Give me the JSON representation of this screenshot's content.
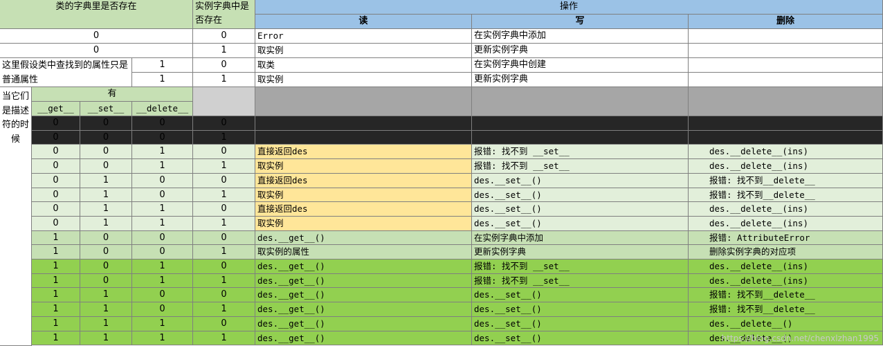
{
  "header": {
    "class_exists": "类的字典里是否存在",
    "instance_exists": "实例字典中是否存在",
    "operation": "操作",
    "read": "读",
    "write": "写",
    "delete": "删除"
  },
  "top_rows": [
    {
      "class": "0",
      "inst": "0",
      "read": "Error",
      "write": "在实例字典中添加",
      "delete": ""
    },
    {
      "class": "0",
      "inst": "1",
      "read": "取实例",
      "write": "更新实例字典",
      "delete": ""
    },
    {
      "class": "1",
      "inst": "0",
      "read": "取类",
      "write": "在实例字典中创建",
      "delete": ""
    },
    {
      "class": "1",
      "inst": "1",
      "read": "取实例",
      "write": "更新实例字典",
      "delete": ""
    }
  ],
  "note": "这里假设类中查找到的属性只是普通属性",
  "descriptor": {
    "side_label": "当它们是描述符的时候",
    "has_label": "有",
    "cols": [
      "__get__",
      "__set__",
      "__delete__"
    ]
  },
  "rows": [
    {
      "g": "0",
      "s": "0",
      "d": "0",
      "inst": "0",
      "read": "",
      "write": "",
      "delete": "",
      "style": "black"
    },
    {
      "g": "0",
      "s": "0",
      "d": "0",
      "inst": "1",
      "read": "",
      "write": "",
      "delete": "",
      "style": "black"
    },
    {
      "g": "0",
      "s": "0",
      "d": "1",
      "inst": "0",
      "read": "直接返回des",
      "write": "报错: 找不到 __set__",
      "delete": "des.__delete__(ins)",
      "style": "pale"
    },
    {
      "g": "0",
      "s": "0",
      "d": "1",
      "inst": "1",
      "read": "取实例",
      "write": "报错: 找不到 __set__",
      "delete": "des.__delete__(ins)",
      "style": "pale"
    },
    {
      "g": "0",
      "s": "1",
      "d": "0",
      "inst": "0",
      "read": "直接返回des",
      "write": "des.__set__()",
      "delete": "报错: 找不到__delete__",
      "style": "pale"
    },
    {
      "g": "0",
      "s": "1",
      "d": "0",
      "inst": "1",
      "read": "取实例",
      "write": "des.__set__()",
      "delete": "报错: 找不到__delete__",
      "style": "pale"
    },
    {
      "g": "0",
      "s": "1",
      "d": "1",
      "inst": "0",
      "read": "直接返回des",
      "write": "des.__set__()",
      "delete": "des.__delete__(ins)",
      "style": "pale"
    },
    {
      "g": "0",
      "s": "1",
      "d": "1",
      "inst": "1",
      "read": "取实例",
      "write": "des.__set__()",
      "delete": "des.__delete__(ins)",
      "style": "pale"
    },
    {
      "g": "1",
      "s": "0",
      "d": "0",
      "inst": "0",
      "read": "des.__get__()",
      "write": "在实例字典中添加",
      "delete": "报错: AttributeError",
      "style": "mid"
    },
    {
      "g": "1",
      "s": "0",
      "d": "0",
      "inst": "1",
      "read": "取实例的属性",
      "write": "更新实例字典",
      "delete": "删除实例字典的对应项",
      "style": "mid"
    },
    {
      "g": "1",
      "s": "0",
      "d": "1",
      "inst": "0",
      "read": "des.__get__()",
      "write": "报错: 找不到 __set__",
      "delete": "des.__delete__(ins)",
      "style": "green"
    },
    {
      "g": "1",
      "s": "0",
      "d": "1",
      "inst": "1",
      "read": "des.__get__()",
      "write": "报错: 找不到 __set__",
      "delete": "des.__delete__(ins)",
      "style": "green"
    },
    {
      "g": "1",
      "s": "1",
      "d": "0",
      "inst": "0",
      "read": "des.__get__()",
      "write": "des.__set__()",
      "delete": "报错: 找不到__delete__",
      "style": "green"
    },
    {
      "g": "1",
      "s": "1",
      "d": "0",
      "inst": "1",
      "read": "des.__get__()",
      "write": "des.__set__()",
      "delete": "报错: 找不到__delete__",
      "style": "green"
    },
    {
      "g": "1",
      "s": "1",
      "d": "1",
      "inst": "0",
      "read": "des.__get__()",
      "write": "des.__set__()",
      "delete": "des.__delete__()",
      "style": "green"
    },
    {
      "g": "1",
      "s": "1",
      "d": "1",
      "inst": "1",
      "read": "des.__get__()",
      "write": "des.__set__()",
      "delete": "des.__delete__()",
      "style": "green"
    }
  ],
  "colors": {
    "header_green": "#c6e0b4",
    "header_blue": "#9bc2e6",
    "gray_light": "#d0d0d0",
    "gray_dark": "#a6a6a6",
    "black": "#262626",
    "pale_green": "#e2efda",
    "mid_green": "#c6e0b4",
    "bright_green": "#92d050",
    "yellow": "#ffe699"
  },
  "watermark": "https://blog.csdn.net/chenxlzhan1995"
}
